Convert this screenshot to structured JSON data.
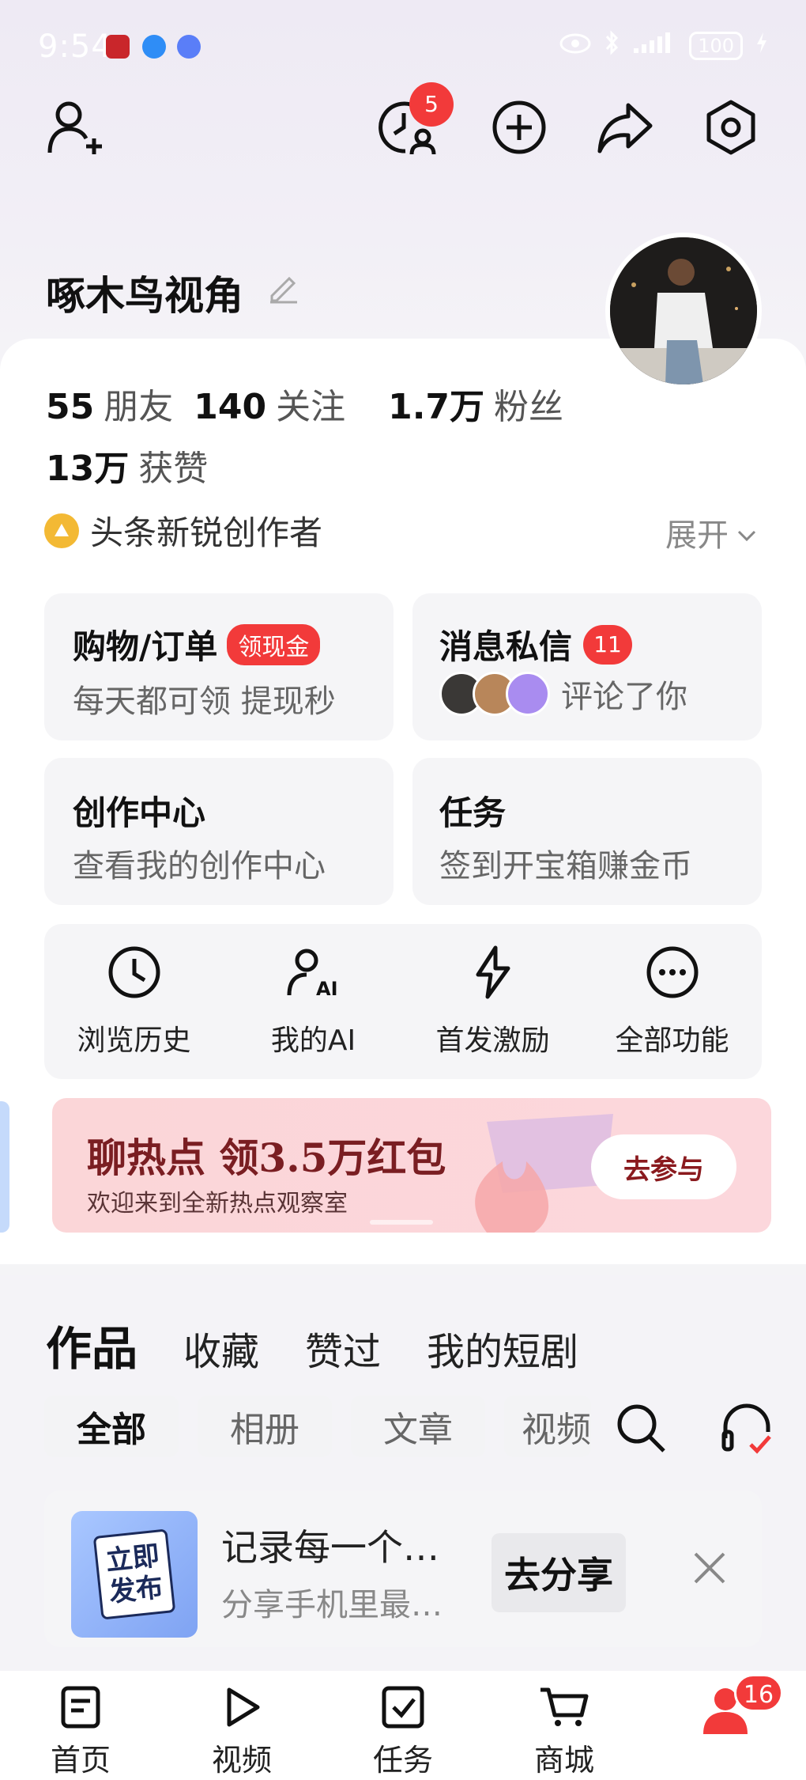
{
  "status_bar": {
    "time": "9:54",
    "battery": "100"
  },
  "header": {
    "add_friend_icon": "add-person-icon",
    "visitors_badge": "5",
    "icons": [
      "visitors-icon",
      "plus-circle-icon",
      "share-icon",
      "settings-icon"
    ]
  },
  "profile": {
    "name": "啄木鸟视角",
    "stats": [
      {
        "num": "55",
        "label": "朋友"
      },
      {
        "num": "140",
        "label": "关注"
      },
      {
        "num": "1.7万",
        "label": "粉丝"
      }
    ],
    "likes": {
      "num": "13万",
      "label": "获赞"
    },
    "creator_badge": "头条新锐创作者",
    "expand_label": "展开"
  },
  "tiles": {
    "shopping": {
      "title": "购物/订单",
      "tag": "领现金",
      "sub": "每天都可领 提现秒"
    },
    "messages": {
      "title": "消息私信",
      "badge": "11",
      "sub": "评论了你"
    },
    "creation": {
      "title": "创作中心",
      "sub": "查看我的创作中心"
    },
    "tasks": {
      "title": "任务",
      "sub": "签到开宝箱赚金币"
    }
  },
  "functions": [
    {
      "label": "浏览历史",
      "icon": "clock-icon"
    },
    {
      "label": "我的AI",
      "icon": "ai-person-icon"
    },
    {
      "label": "首发激励",
      "icon": "lightning-icon"
    },
    {
      "label": "全部功能",
      "icon": "more-icon"
    }
  ],
  "banner": {
    "title": "聊热点 领3.5万红包",
    "subtitle": "欢迎来到全新热点观察室",
    "button": "去参与"
  },
  "content_tabs": [
    "作品",
    "收藏",
    "赞过",
    "我的短剧"
  ],
  "filter_chips": [
    "全部",
    "相册",
    "文章",
    "视频"
  ],
  "share_card": {
    "thumb_text_1": "立即",
    "thumb_text_2": "发布",
    "title": "记录每一个…",
    "subtitle": "分享手机里最…",
    "button": "去分享"
  },
  "bottom_nav": [
    {
      "label": "首页",
      "icon": "home-doc-icon"
    },
    {
      "label": "视频",
      "icon": "play-icon"
    },
    {
      "label": "任务",
      "icon": "checkbox-icon"
    },
    {
      "label": "商城",
      "icon": "cart-icon"
    }
  ],
  "bottom_badge": "16",
  "colors": {
    "accent_red": "#f23a3a",
    "banner_bg": "#fcd7dc",
    "banner_text": "#7a1e22"
  }
}
